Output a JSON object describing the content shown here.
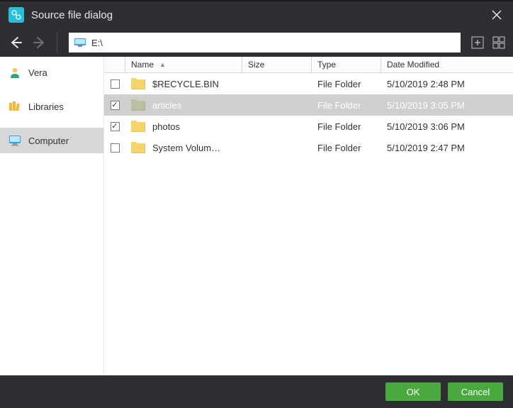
{
  "title": "Source file dialog",
  "path": "E:\\",
  "icons": {
    "back": "back-icon",
    "forward": "forward-icon",
    "close": "close-icon",
    "add": "plus-box-icon",
    "grid": "grid-view-icon",
    "drive": "monitor-icon"
  },
  "sidebar": {
    "items": [
      {
        "label": "Vera",
        "icon": "user-icon"
      },
      {
        "label": "Libraries",
        "icon": "libraries-icon"
      },
      {
        "label": "Computer",
        "icon": "computer-icon"
      }
    ],
    "selected_index": 2
  },
  "columns": {
    "name": "Name",
    "size": "Size",
    "type": "Type",
    "date": "Date Modified",
    "sort_on": "name",
    "sort_dir": "asc"
  },
  "rows": [
    {
      "checked": false,
      "name": "$RECYCLE.BIN",
      "size": "",
      "type": "File Folder",
      "date": "5/10/2019 2:48 PM",
      "selected": false,
      "muted": false
    },
    {
      "checked": true,
      "name": "articles",
      "size": "",
      "type": "File Folder",
      "date": "5/10/2019 3:05 PM",
      "selected": true,
      "muted": true
    },
    {
      "checked": true,
      "name": "photos",
      "size": "",
      "type": "File Folder",
      "date": "5/10/2019 3:06 PM",
      "selected": false,
      "muted": false
    },
    {
      "checked": false,
      "name": "System Volum…",
      "size": "",
      "type": "File Folder",
      "date": "5/10/2019 2:47 PM",
      "selected": false,
      "muted": false
    }
  ],
  "buttons": {
    "ok": "OK",
    "cancel": "Cancel"
  },
  "colors": {
    "accent": "#23c0db",
    "primary_btn": "#49a93f",
    "chrome": "#2d2f33"
  }
}
